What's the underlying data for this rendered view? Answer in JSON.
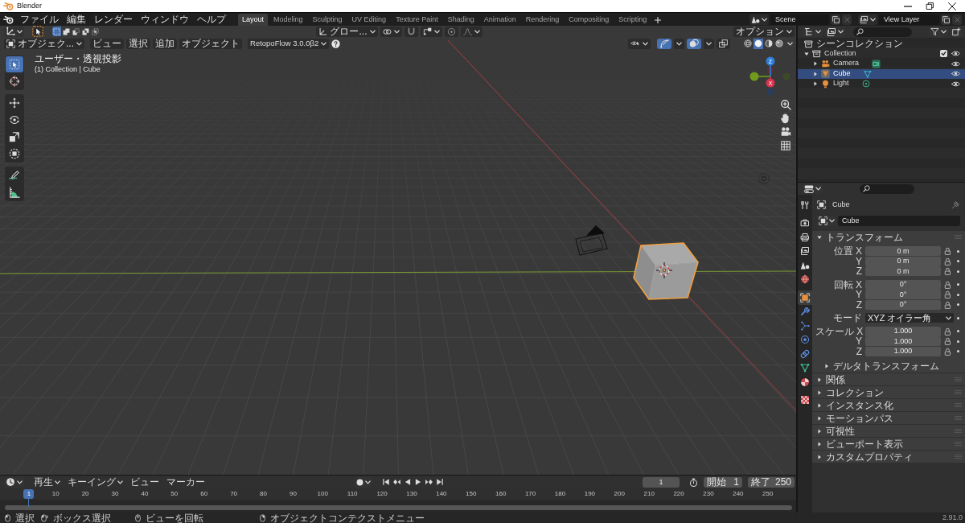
{
  "window": {
    "title": "Blender"
  },
  "menu_bar": {
    "menus": [
      "ファイル",
      "編集",
      "レンダー",
      "ウィンドウ",
      "ヘルプ"
    ],
    "workspaces": [
      {
        "label": "Layout",
        "selected": true
      },
      {
        "label": "Modeling",
        "selected": false
      },
      {
        "label": "Sculpting",
        "selected": false
      },
      {
        "label": "UV Editing",
        "selected": false
      },
      {
        "label": "Texture Paint",
        "selected": false
      },
      {
        "label": "Shading",
        "selected": false
      },
      {
        "label": "Animation",
        "selected": false
      },
      {
        "label": "Rendering",
        "selected": false
      },
      {
        "label": "Compositing",
        "selected": false
      },
      {
        "label": "Scripting",
        "selected": false
      }
    ],
    "scene": "Scene",
    "view_layer": "View Layer"
  },
  "viewport": {
    "header": {
      "select_modes": [
        {
          "kind": "set",
          "selected": true
        },
        {
          "kind": "extend",
          "selected": false
        },
        {
          "kind": "subtract",
          "selected": false
        },
        {
          "kind": "difference",
          "selected": false
        },
        {
          "kind": "intersect",
          "selected": false
        }
      ],
      "orientation": "グロー...",
      "options": "オプション",
      "mode": "オブジェク...",
      "menus": [
        "ビュー",
        "選択",
        "追加",
        "オブジェクト"
      ],
      "addon": "RetopoFlow 3.0.0β2",
      "toggles": [
        {
          "kind": "gizmo",
          "on": true
        },
        {
          "kind": "overlay",
          "on": true
        },
        {
          "kind": "xray",
          "on": false
        }
      ],
      "shading": [
        {
          "kind": "wireframe",
          "selected": false
        },
        {
          "kind": "solid",
          "selected": true
        },
        {
          "kind": "material",
          "selected": false
        },
        {
          "kind": "rendered",
          "selected": false
        }
      ]
    },
    "view_name": "ユーザー・透視投影",
    "view_info": "(1) Collection | Cube",
    "axis_labels": {
      "z": "Z",
      "x": "X"
    },
    "tool_groups": [
      [
        {
          "kind": "select",
          "selected": true
        },
        {
          "kind": "cursor",
          "selected": false
        }
      ],
      [
        {
          "kind": "move",
          "selected": false
        },
        {
          "kind": "rotate",
          "selected": false
        },
        {
          "kind": "scale",
          "selected": false
        },
        {
          "kind": "transform",
          "selected": false
        }
      ],
      [
        {
          "kind": "annotate",
          "selected": false
        },
        {
          "kind": "measure",
          "selected": false
        }
      ]
    ]
  },
  "timeline": {
    "menus": [
      {
        "label": "再生",
        "kind": "dropdown"
      },
      {
        "label": "キーイング",
        "kind": "dropdown"
      },
      {
        "label": "ビュー",
        "kind": "menu"
      },
      {
        "label": "マーカー",
        "kind": "menu"
      }
    ],
    "current_frame": "1",
    "start_label": "開始",
    "start": "1",
    "end_label": "終了",
    "end": "250",
    "playhead": "1",
    "ticks": [
      "10",
      "20",
      "30",
      "40",
      "50",
      "60",
      "70",
      "80",
      "90",
      "100",
      "110",
      "120",
      "130",
      "140",
      "150",
      "160",
      "170",
      "180",
      "190",
      "200",
      "210",
      "220",
      "230",
      "240",
      "250"
    ]
  },
  "outliner": {
    "root": "シーンコレクション",
    "items": [
      {
        "label": "Collection",
        "kind": "collection",
        "expanded": true,
        "checked": true,
        "visible": true,
        "selected": false,
        "children": [
          {
            "label": "Camera",
            "kind": "camera",
            "expanded": false,
            "visible": true,
            "selected": false
          },
          {
            "label": "Cube",
            "kind": "mesh",
            "expanded": false,
            "visible": true,
            "selected": true
          },
          {
            "label": "Light",
            "kind": "light",
            "expanded": false,
            "visible": true,
            "selected": false
          }
        ]
      }
    ]
  },
  "properties": {
    "tab_groups": [
      [
        {
          "kind": "tool",
          "selected": false
        }
      ],
      [
        {
          "kind": "render",
          "selected": false
        },
        {
          "kind": "output",
          "selected": false
        },
        {
          "kind": "viewlayer",
          "selected": false
        },
        {
          "kind": "scene",
          "selected": false
        },
        {
          "kind": "world",
          "selected": false
        }
      ],
      [
        {
          "kind": "object",
          "selected": true
        },
        {
          "kind": "modifiers",
          "selected": false
        },
        {
          "kind": "particles",
          "selected": false
        },
        {
          "kind": "physics",
          "selected": false
        },
        {
          "kind": "constraints",
          "selected": false
        },
        {
          "kind": "data",
          "selected": false
        },
        {
          "kind": "material",
          "selected": false
        }
      ],
      [
        {
          "kind": "texture",
          "selected": false
        }
      ]
    ],
    "context": "Cube",
    "name": "Cube",
    "panels": [
      {
        "title": "トランスフォーム",
        "expanded": true,
        "groups": [
          [
            {
              "label": "位置 X",
              "value": "0 m",
              "kind": "number",
              "locked": false
            },
            {
              "label": "Y",
              "value": "0 m",
              "kind": "number",
              "locked": false
            },
            {
              "label": "Z",
              "value": "0 m",
              "kind": "number",
              "locked": false
            }
          ],
          [
            {
              "label": "回転 X",
              "value": "0°",
              "kind": "number",
              "locked": false
            },
            {
              "label": "Y",
              "value": "0°",
              "kind": "number",
              "locked": false
            },
            {
              "label": "Z",
              "value": "0°",
              "kind": "number",
              "locked": false
            }
          ],
          [
            {
              "label": "モード",
              "value": "XYZ オイラー角",
              "kind": "dropdown"
            }
          ],
          [
            {
              "label": "スケール X",
              "value": "1.000",
              "kind": "number",
              "locked": false
            },
            {
              "label": "Y",
              "value": "1.000",
              "kind": "number",
              "locked": false
            },
            {
              "label": "Z",
              "value": "1.000",
              "kind": "number",
              "locked": false
            }
          ]
        ],
        "subpanels": [
          {
            "title": "デルタトランスフォーム",
            "expanded": false
          }
        ]
      },
      {
        "title": "関係",
        "expanded": false
      },
      {
        "title": "コレクション",
        "expanded": false
      },
      {
        "title": "インスタンス化",
        "expanded": false
      },
      {
        "title": "モーションパス",
        "expanded": false
      },
      {
        "title": "可視性",
        "expanded": false
      },
      {
        "title": "ビューポート表示",
        "expanded": false
      },
      {
        "title": "カスタムプロパティ",
        "expanded": false
      }
    ]
  },
  "status_bar": {
    "items": [
      {
        "kind": "left",
        "label": "選択"
      },
      {
        "kind": "drag",
        "label": "ボックス選択"
      },
      {
        "kind": "middle",
        "label": "ビューを回転"
      },
      {
        "kind": "right",
        "label": "オブジェクトコンテクストメニュー"
      }
    ],
    "version": "2.91.0"
  }
}
